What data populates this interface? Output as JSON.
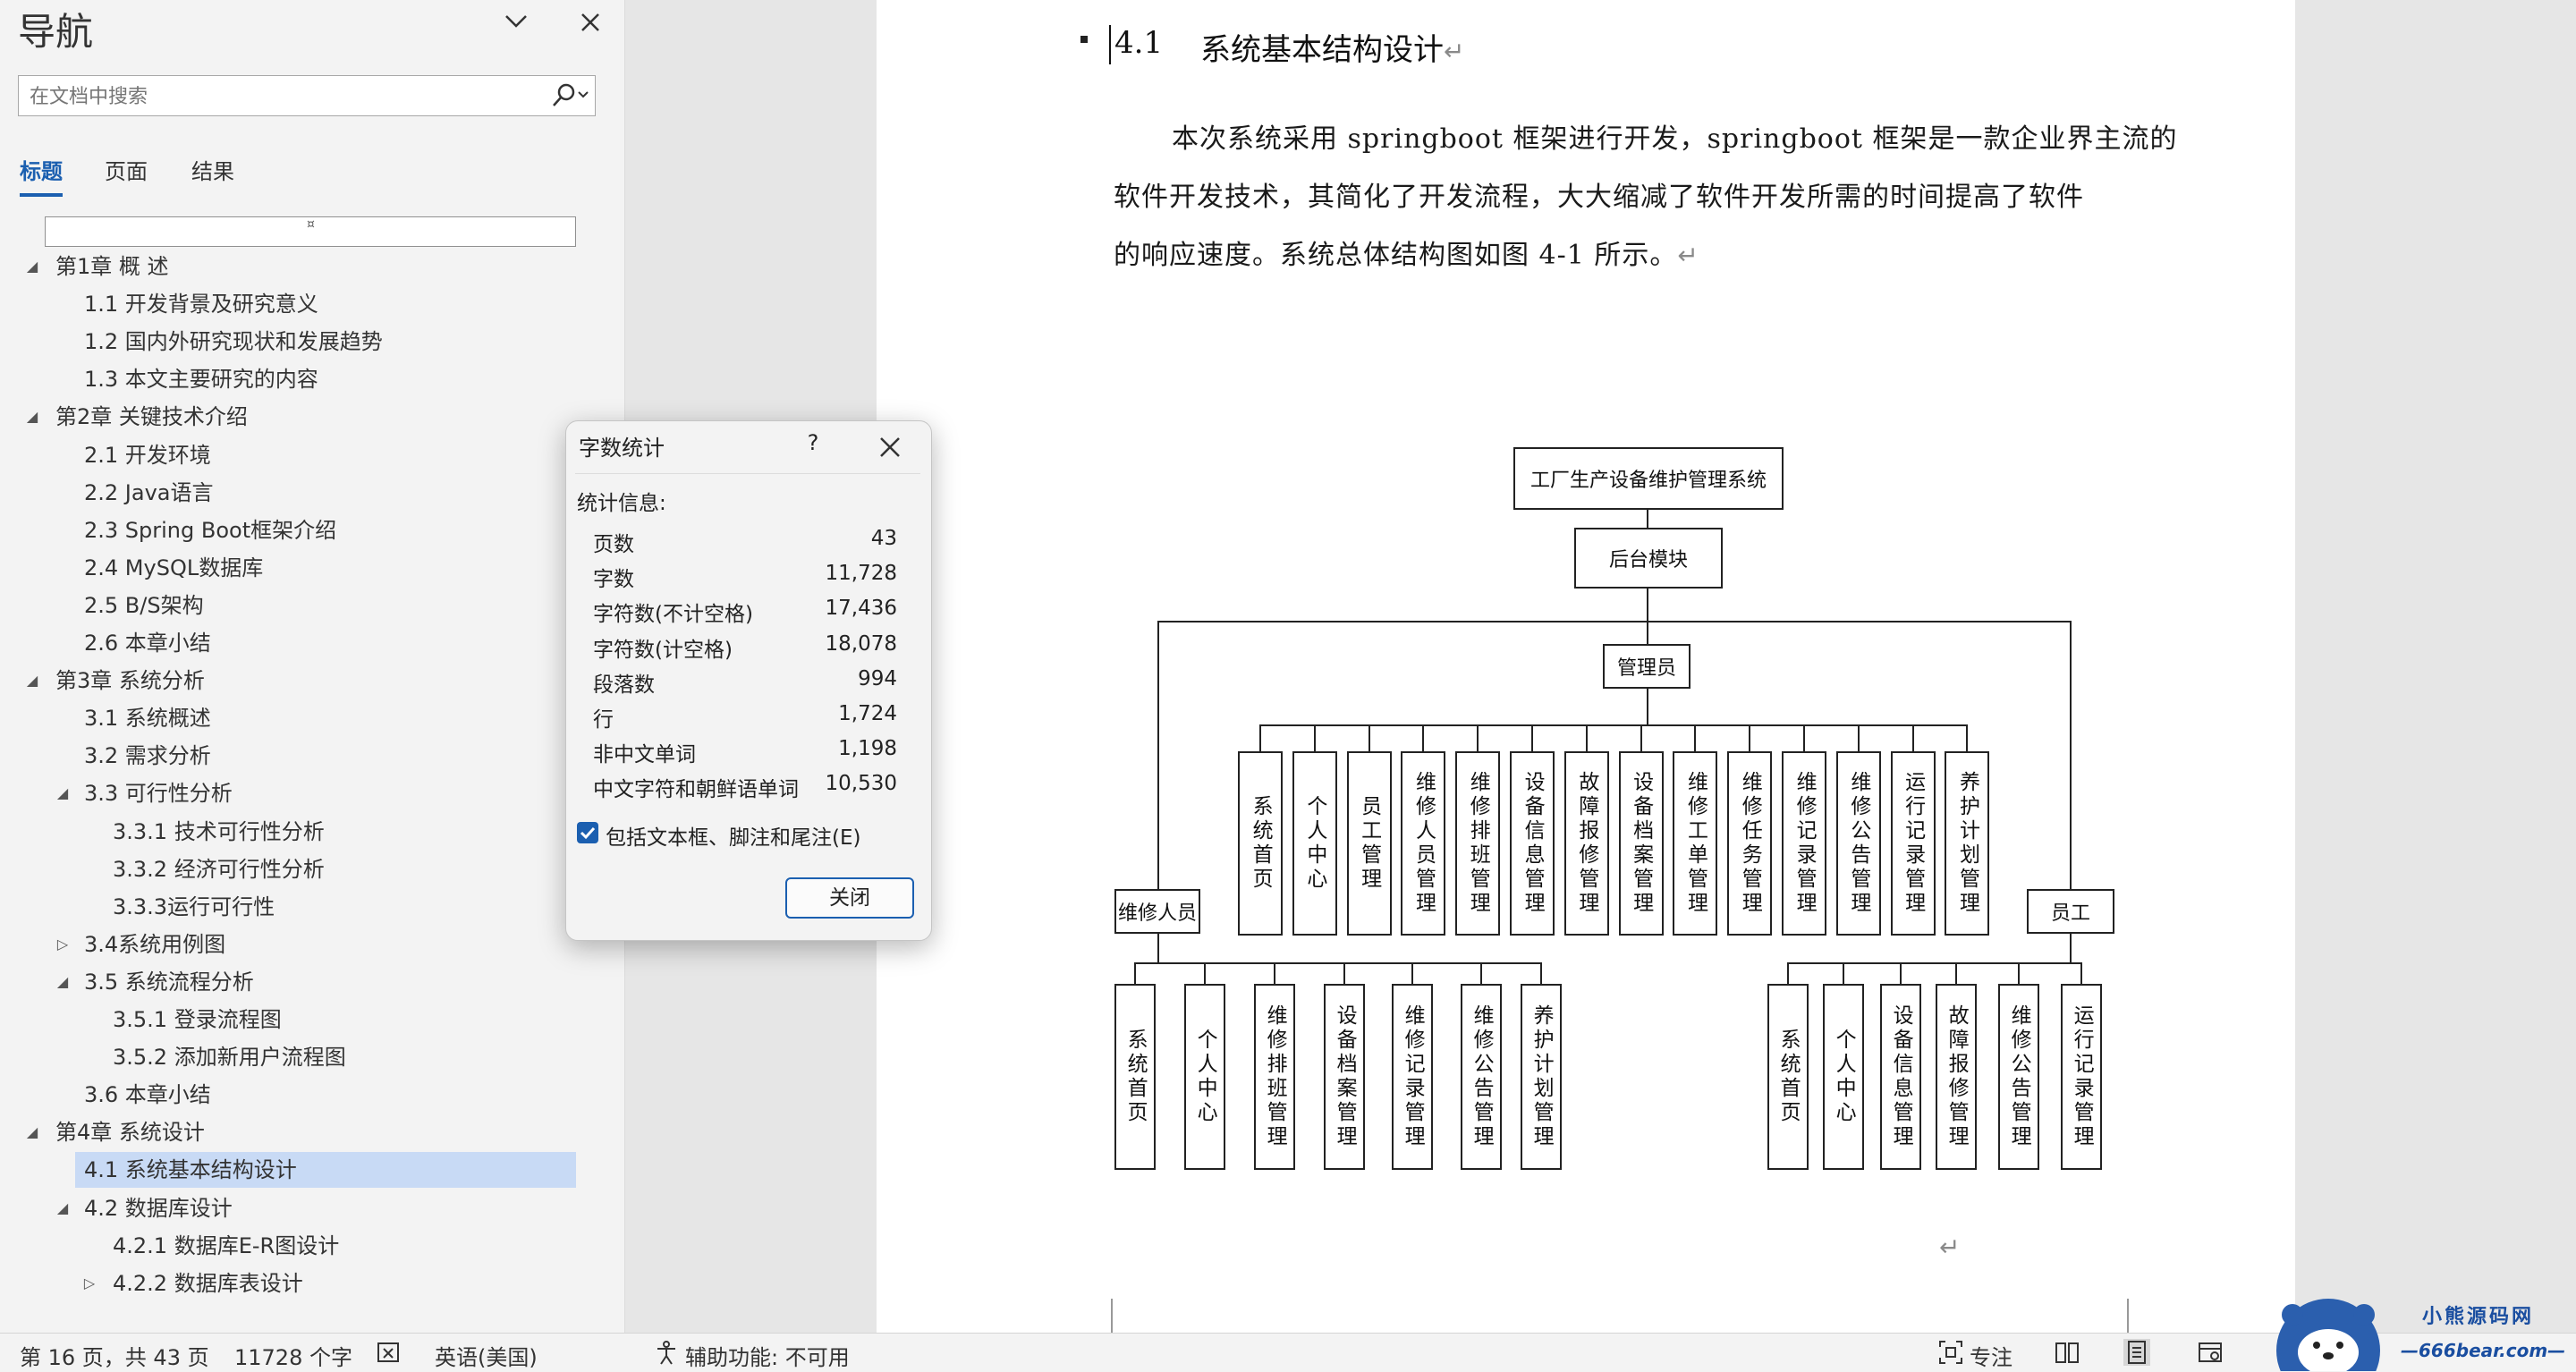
{
  "nav": {
    "title": "导航",
    "search_placeholder": "在文档中搜索",
    "tabs": [
      "标题",
      "页面",
      "结果"
    ],
    "dropdown_mark": "¤",
    "items": [
      {
        "label": "第1章 概 述",
        "level": 1,
        "arrow": "◢"
      },
      {
        "label": "1.1 开发背景及研究意义",
        "level": 2
      },
      {
        "label": "1.2 国内外研究现状和发展趋势",
        "level": 2
      },
      {
        "label": "1.3 本文主要研究的内容",
        "level": 2
      },
      {
        "label": "第2章 关键技术介绍",
        "level": 1,
        "arrow": "◢"
      },
      {
        "label": "2.1 开发环境",
        "level": 2
      },
      {
        "label": "2.2 Java语言",
        "level": 2
      },
      {
        "label": "2.3 Spring Boot框架介绍",
        "level": 2
      },
      {
        "label": "2.4 MySQL数据库",
        "level": 2
      },
      {
        "label": "2.5 B/S架构",
        "level": 2
      },
      {
        "label": "2.6 本章小结",
        "level": 2
      },
      {
        "label": "第3章 系统分析",
        "level": 1,
        "arrow": "◢"
      },
      {
        "label": "3.1 系统概述",
        "level": 2
      },
      {
        "label": "3.2 需求分析",
        "level": 2
      },
      {
        "label": "3.3 可行性分析",
        "level": 2,
        "arrow": "◢"
      },
      {
        "label": "3.3.1 技术可行性分析",
        "level": 3
      },
      {
        "label": "3.3.2 经济可行性分析",
        "level": 3
      },
      {
        "label": "3.3.3运行可行性",
        "level": 3
      },
      {
        "label": "3.4系统用例图",
        "level": 2,
        "arrow": "▷"
      },
      {
        "label": "3.5 系统流程分析",
        "level": 2,
        "arrow": "◢"
      },
      {
        "label": "3.5.1 登录流程图",
        "level": 3
      },
      {
        "label": "3.5.2 添加新用户流程图",
        "level": 3
      },
      {
        "label": "3.6 本章小结",
        "level": 2
      },
      {
        "label": "第4章 系统设计",
        "level": 1,
        "arrow": "◢"
      },
      {
        "label": "4.1 系统基本结构设计",
        "level": 2,
        "selected": true
      },
      {
        "label": "4.2 数据库设计",
        "level": 2,
        "arrow": "◢"
      },
      {
        "label": "4.2.1 数据库E-R图设计",
        "level": 3
      },
      {
        "label": "4.2.2 数据库表设计",
        "level": 3,
        "arrow": "▷"
      }
    ]
  },
  "document": {
    "heading_number": "4.1",
    "heading_title": "系统基本结构设计",
    "return_mark": "↵",
    "para_lines": [
      "本次系统采用 springboot 框架进行开发，springboot 框架是一款企业界主流的",
      "软件开发技术，其简化了开发流程，大大缩减了软件开发所需的时间提高了软件",
      "的响应速度。系统总体结构图如图 4-1 所示。"
    ],
    "diagram": {
      "root": "工厂生产设备维护管理系统",
      "module": "后台模块",
      "admin": "管理员",
      "admin_children": [
        "系统首页",
        "个人中心",
        "员工管理",
        "维修人员管理",
        "维修排班管理",
        "设备信息管理",
        "故障报修管理",
        "设备档案管理",
        "维修工单管理",
        "维修任务管理",
        "维修记录管理",
        "维修公告管理",
        "运行记录管理",
        "养护计划管理"
      ],
      "repair": "维修人员",
      "repair_children": [
        "系统首页",
        "个人中心",
        "维修排班管理",
        "设备档案管理",
        "维修记录管理",
        "维修公告管理",
        "养护计划管理"
      ],
      "staff": "员工",
      "staff_children": [
        "系统首页",
        "个人中心",
        "设备信息管理",
        "故障报修管理",
        "维修公告管理",
        "运行记录管理"
      ]
    }
  },
  "dialog": {
    "title": "字数统计",
    "help": "?",
    "info_label": "统计信息:",
    "stats": [
      {
        "k": "页数",
        "v": "43"
      },
      {
        "k": "字数",
        "v": "11,728"
      },
      {
        "k": "字符数(不计空格)",
        "v": "17,436"
      },
      {
        "k": "字符数(计空格)",
        "v": "18,078"
      },
      {
        "k": "段落数",
        "v": "994"
      },
      {
        "k": "行",
        "v": "1,724"
      },
      {
        "k": "非中文单词",
        "v": "1,198"
      },
      {
        "k": "中文字符和朝鲜语单词",
        "v": "10,530"
      }
    ],
    "checkbox_label": "包括文本框、脚注和尾注(E)",
    "checkbox_checked": true,
    "close_label": "关闭"
  },
  "status": {
    "page": "第 16 页，共 43 页",
    "words": "11728 个字",
    "language": "英语(美国)",
    "accessibility": "辅助功能: 不可用",
    "focus": "专注"
  },
  "watermark": {
    "line1": "小熊源码网",
    "line2": "—666bear.com—"
  },
  "colors": {
    "accent": "#1b5fb0",
    "selection": "#c8daf5"
  }
}
